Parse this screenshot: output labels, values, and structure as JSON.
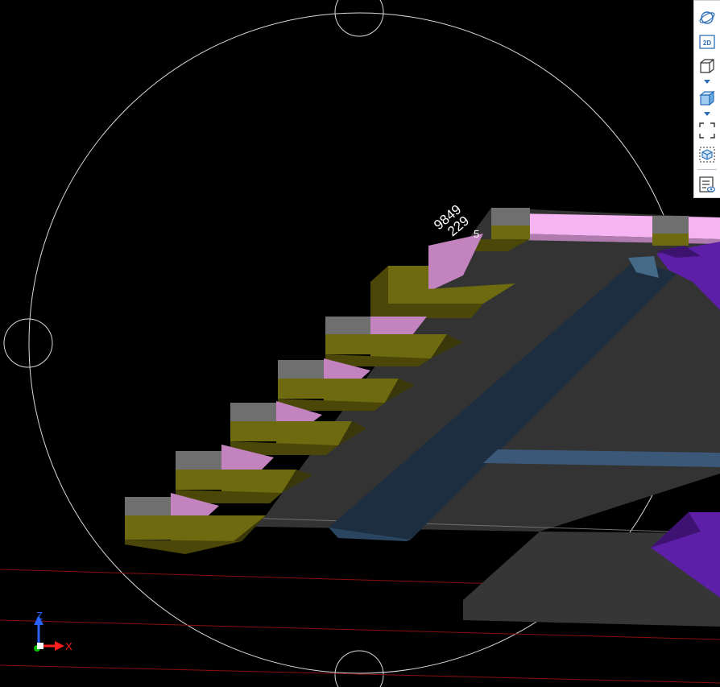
{
  "viewport": {
    "background": "#000000",
    "dimension_labels": [
      "9849",
      "229"
    ],
    "cut_label": "5"
  },
  "axes": {
    "z_label": "Z",
    "x_label": "X",
    "z_color": "#2962ff",
    "x_color": "#ff1e1e",
    "origin_color": "#00c000"
  },
  "view_cube_toolbar": {
    "buttons": [
      {
        "icon": "orbit-icon"
      },
      {
        "icon": "view-2d-icon",
        "label": "2D"
      },
      {
        "icon": "view-3d-wireframe-icon"
      },
      {
        "icon": "view-3d-shaded-icon"
      },
      {
        "icon": "zoom-extents-icon"
      },
      {
        "icon": "zoom-selection-icon"
      },
      {
        "icon": "view-properties-icon"
      }
    ]
  },
  "colors": {
    "slab": "#333333",
    "beam": "#1c2e3f",
    "olive": "#6e6a10",
    "olive_dark": "#4a4708",
    "grey_cap": "#6f6f6f",
    "pink": "#c383bf",
    "pink_light": "#f7b4f3",
    "purple": "#5d1fa8",
    "nav_circle": "#d9d9d9",
    "grid_line": "#8a1010"
  }
}
